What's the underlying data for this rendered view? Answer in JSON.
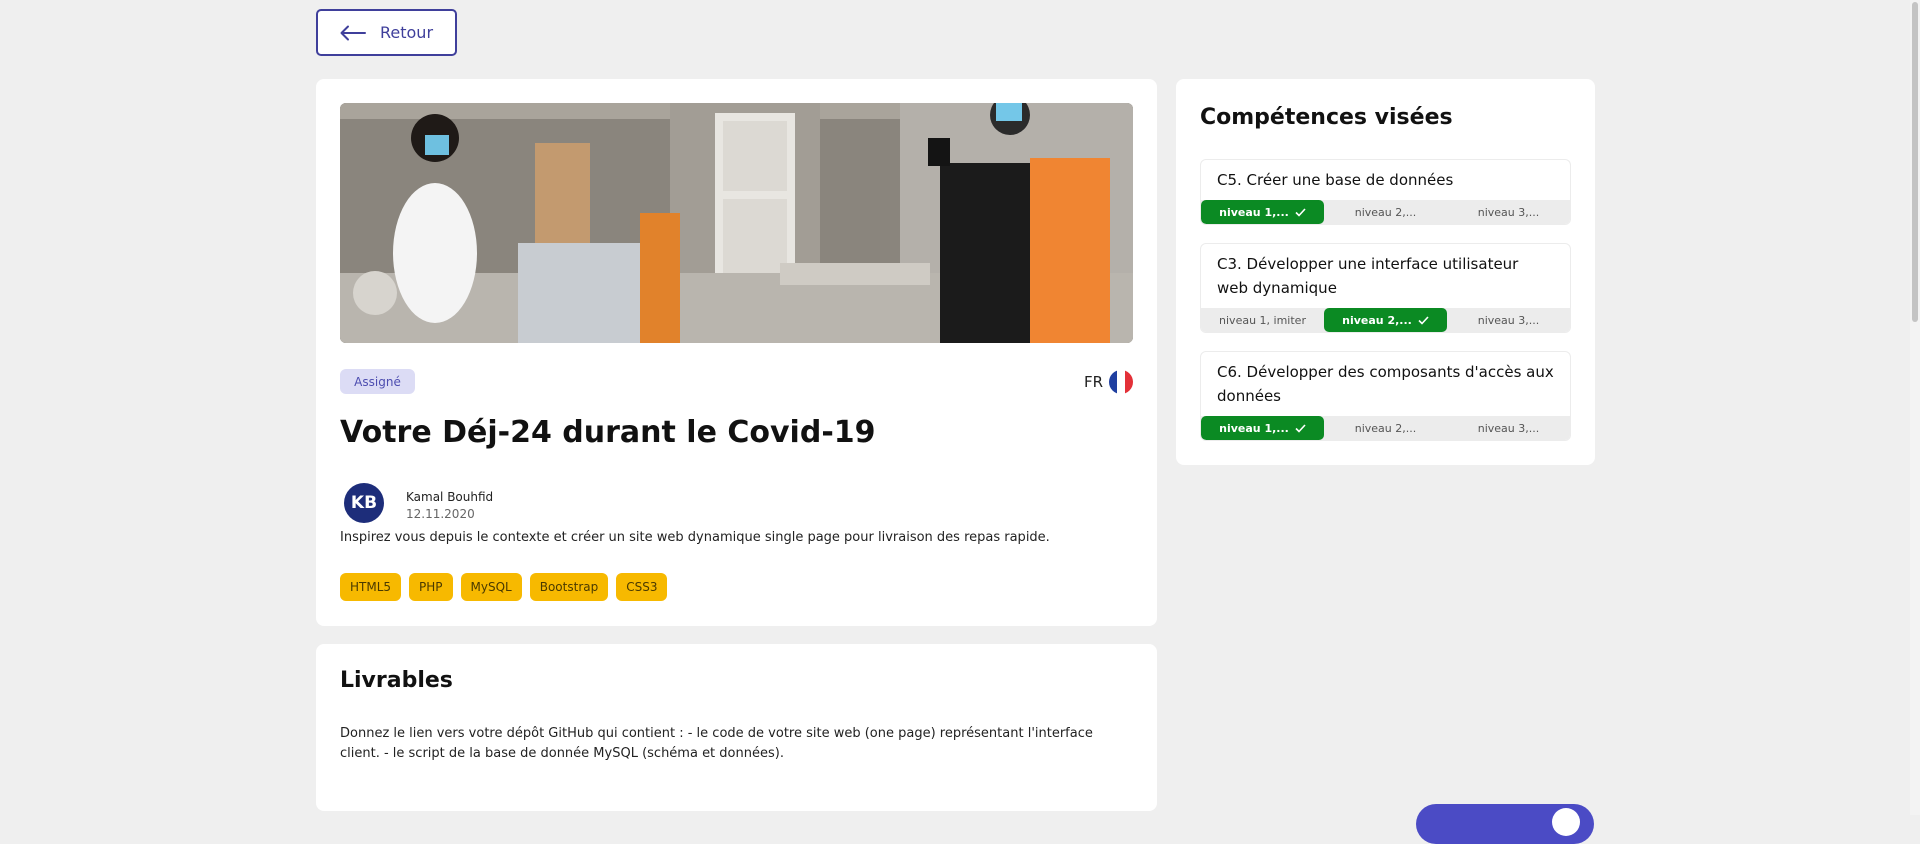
{
  "nav": {
    "back_label": "Retour"
  },
  "project": {
    "status": "Assigné",
    "language": "FR",
    "title": "Votre Déj-24 durant le Covid-19",
    "author": {
      "initials": "KB",
      "name": "Kamal Bouhfid",
      "date": "12.11.2020"
    },
    "description": "Inspirez vous depuis le contexte et créer un site web dynamique single page pour livraison des repas rapide.",
    "tags": [
      "HTML5",
      "PHP",
      "MySQL",
      "Bootstrap",
      "CSS3"
    ]
  },
  "livrables": {
    "title": "Livrables",
    "text": "Donnez le lien vers votre dépôt GitHub qui contient : - le code de votre site web (one page) représentant l'interface client. - le script de la base de donnée MySQL (schéma et données)."
  },
  "competences": {
    "title": "Compétences visées",
    "items": [
      {
        "title": "C5. Créer une base de données",
        "levels": [
          "niveau 1,...",
          "niveau 2,...",
          "niveau 3,..."
        ],
        "active_level": 1
      },
      {
        "title": "C3. Développer une interface utilisateur web dynamique",
        "levels": [
          "niveau 1, imiter",
          "niveau 2,...",
          "niveau 3,..."
        ],
        "active_level": 2
      },
      {
        "title": "C6. Développer des composants d'accès aux données",
        "levels": [
          "niveau 1,...",
          "niveau 2,...",
          "niveau 3,..."
        ],
        "active_level": 1
      }
    ]
  },
  "colors": {
    "accent": "#3f3f9b",
    "tag": "#f7b900",
    "level_active": "#0b8a23",
    "avatar": "#1d2d7a"
  },
  "icons": {
    "back": "arrow-left-icon",
    "check": "check-icon",
    "flag": "france-flag-icon"
  }
}
